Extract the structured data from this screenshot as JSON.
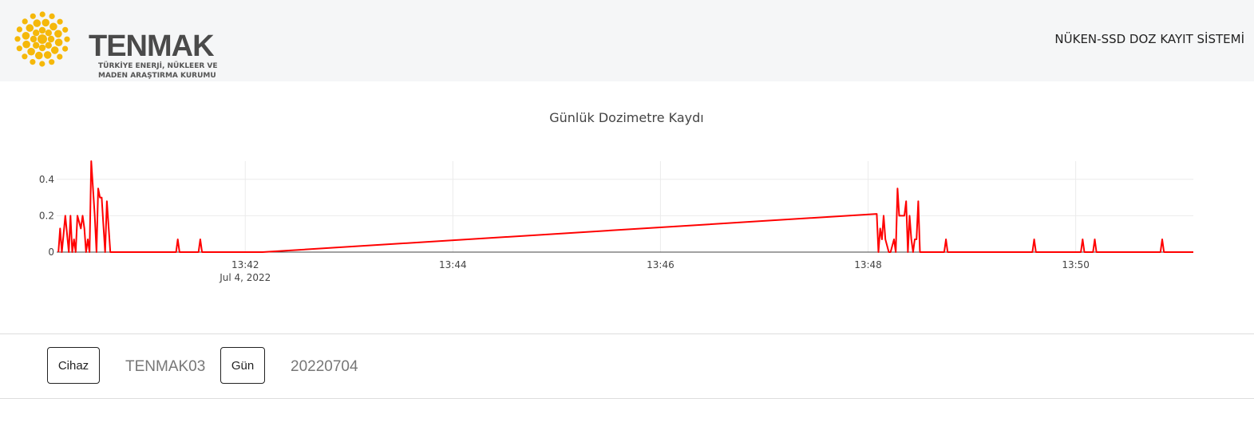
{
  "header": {
    "brand_name": "TENMAK",
    "brand_subtitle": "TÜRKİYE ENERJİ, NÜKLEER VE\nMADEN ARAŞTIRMA KURUMU",
    "system_title": "NÜKEN-SSD DOZ KAYIT SİSTEMİ",
    "logo_color": "#f5b80a"
  },
  "chart_data": {
    "type": "line",
    "title": "Günlük Dozimetre Kaydı",
    "xlabel": "",
    "ylabel": "",
    "line_color": "#ff0000",
    "grid": true,
    "x_ticks": [
      "13:42",
      "13:44",
      "13:46",
      "13:48",
      "13:50"
    ],
    "x_date_label": "Jul 4, 2022",
    "y_ticks": [
      0,
      0.2,
      0.4
    ],
    "xlim": [
      "13:40:11",
      "13:51:08"
    ],
    "ylim": [
      0,
      0.5
    ],
    "series": [
      {
        "x": [
          "13:40:12",
          "13:40:13",
          "13:40:14",
          "13:40:16",
          "13:40:18",
          "13:40:19",
          "13:40:20",
          "13:40:21",
          "13:40:22",
          "13:40:23",
          "13:40:25",
          "13:40:26",
          "13:40:27",
          "13:40:28",
          "13:40:29",
          "13:40:30",
          "13:40:31",
          "13:40:33",
          "13:40:34",
          "13:40:35",
          "13:40:36",
          "13:40:37",
          "13:40:38",
          "13:40:39",
          "13:40:40",
          "13:40:42",
          "13:40:43",
          "13:40:44",
          "13:40:45",
          "13:40:46",
          "13:40:47",
          "13:41:20",
          "13:41:21",
          "13:41:22",
          "13:41:33",
          "13:41:34",
          "13:41:35",
          "13:42:10",
          "13:48:05",
          "13:48:06",
          "13:48:07",
          "13:48:08",
          "13:48:09",
          "13:48:10",
          "13:48:12",
          "13:48:13",
          "13:48:15",
          "13:48:16",
          "13:48:17",
          "13:48:18",
          "13:48:20",
          "13:48:21",
          "13:48:22",
          "13:48:23",
          "13:48:24",
          "13:48:25",
          "13:48:26",
          "13:48:27",
          "13:48:28",
          "13:48:29",
          "13:48:30",
          "13:48:31",
          "13:48:32",
          "13:48:33",
          "13:48:34",
          "13:48:44",
          "13:48:45",
          "13:48:46",
          "13:49:35",
          "13:49:36",
          "13:49:37",
          "13:50:03",
          "13:50:04",
          "13:50:05",
          "13:50:10",
          "13:50:11",
          "13:50:12",
          "13:50:49",
          "13:50:50",
          "13:50:51",
          "13:51:08"
        ],
        "values": [
          0.0,
          0.13,
          0.0,
          0.2,
          0.0,
          0.2,
          0.0,
          0.07,
          0.0,
          0.2,
          0.13,
          0.2,
          0.13,
          0.0,
          0.07,
          0.0,
          0.5,
          0.2,
          0.0,
          0.35,
          0.3,
          0.3,
          0.15,
          0.0,
          0.28,
          0.0,
          0.0,
          0.0,
          0.0,
          0.0,
          0.0,
          0.0,
          0.07,
          0.0,
          0.0,
          0.07,
          0.0,
          0.0,
          0.21,
          0.0,
          0.13,
          0.07,
          0.2,
          0.07,
          0.0,
          0.0,
          0.07,
          0.0,
          0.35,
          0.2,
          0.2,
          0.2,
          0.28,
          0.0,
          0.2,
          0.07,
          0.0,
          0.07,
          0.07,
          0.28,
          0.0,
          0.0,
          0.0,
          0.0,
          0.0,
          0.0,
          0.07,
          0.0,
          0.0,
          0.07,
          0.0,
          0.0,
          0.07,
          0.0,
          0.0,
          0.07,
          0.0,
          0.0,
          0.07,
          0.0,
          0.0
        ]
      }
    ]
  },
  "controls": {
    "device_button": "Cihaz",
    "device_value": "TENMAK03",
    "day_button": "Gün",
    "day_value": "20220704"
  }
}
